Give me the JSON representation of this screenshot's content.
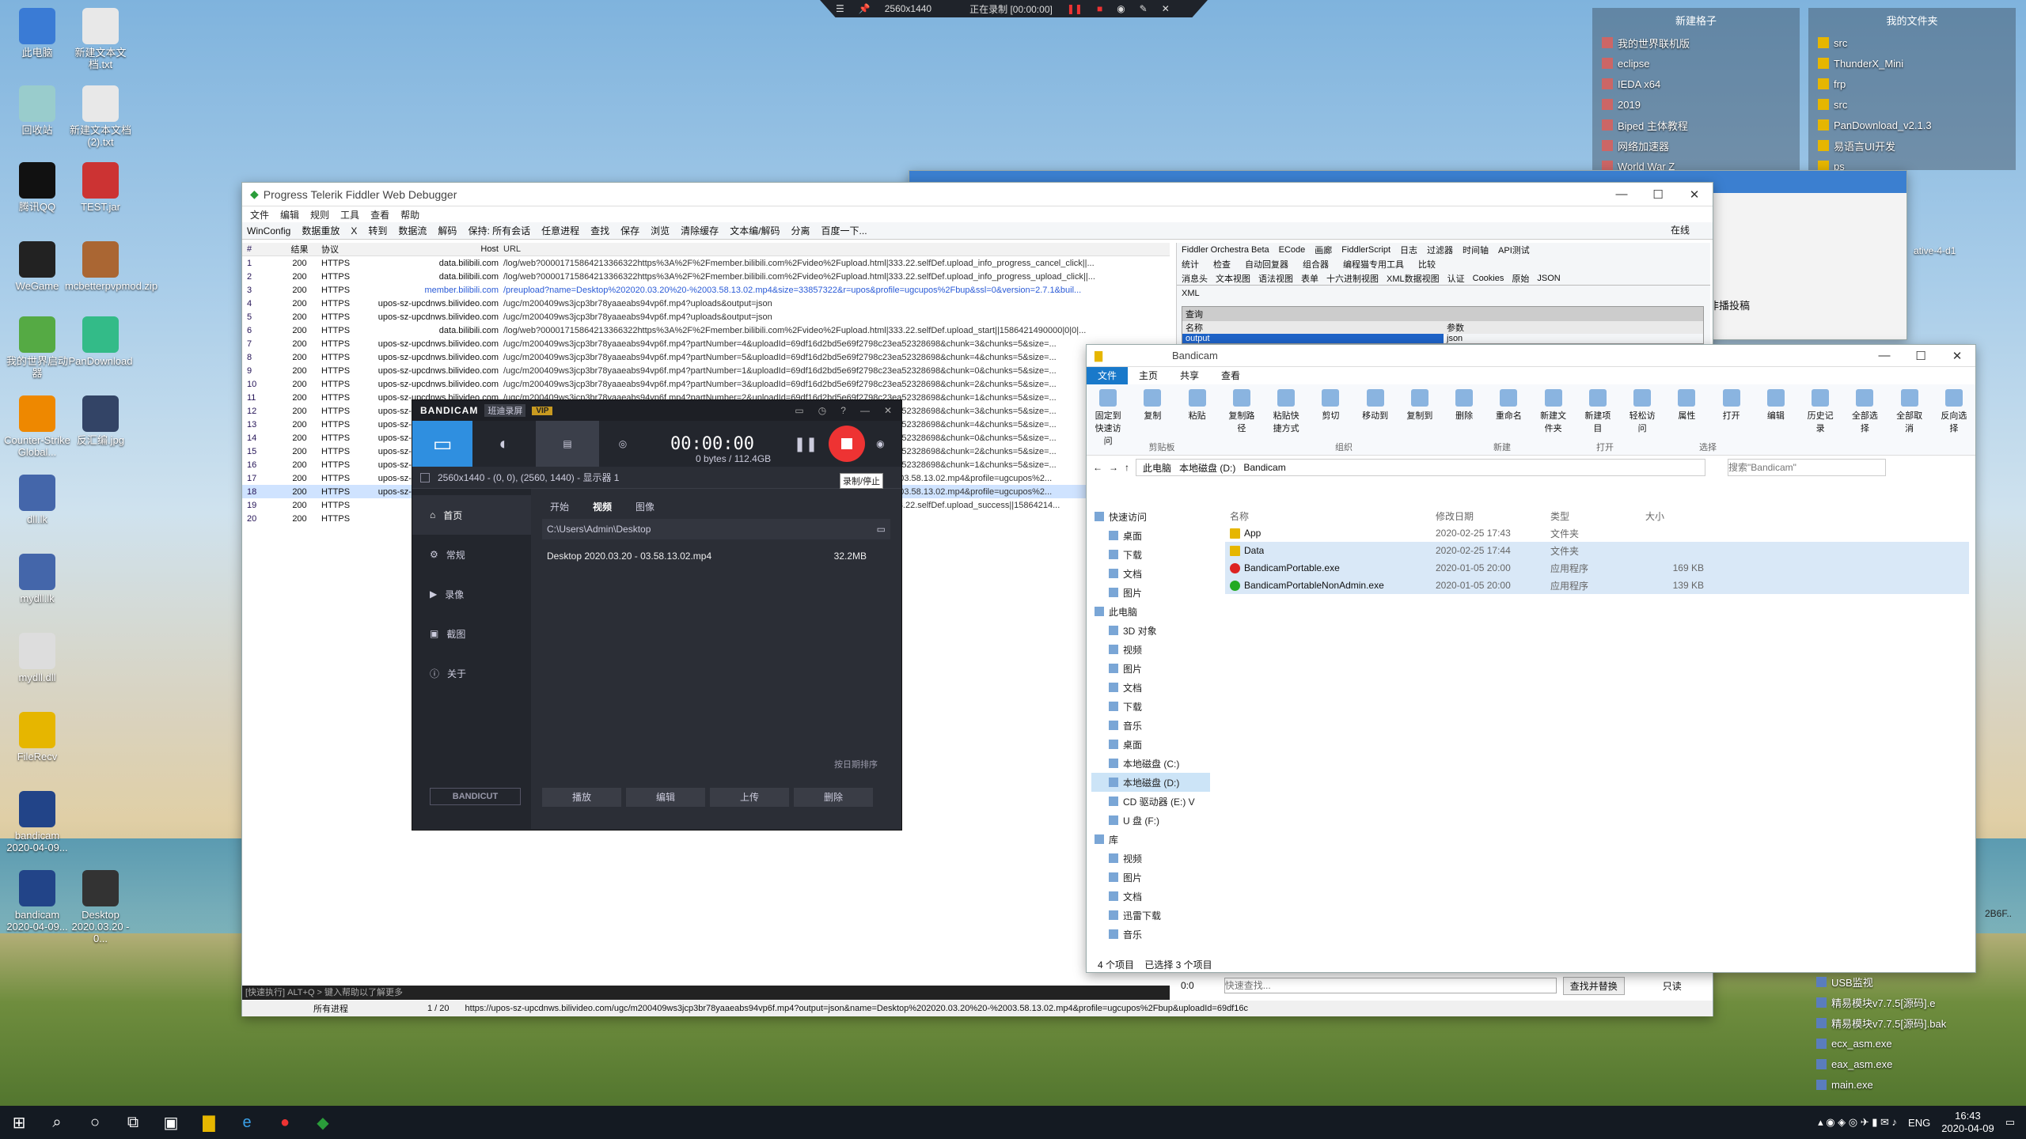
{
  "recording_bar": {
    "resolution": "2560x1440",
    "status": "正在录制 [00:00:00]"
  },
  "desktop_icons": [
    {
      "label": "此电脑",
      "color": "#3a7bd5"
    },
    {
      "label": "新建文本文档.txt",
      "color": "#e8e8e8"
    },
    {
      "label": "回收站",
      "color": "#9cc"
    },
    {
      "label": "新建文本文档 (2).txt",
      "color": "#e8e8e8"
    },
    {
      "label": "腾讯QQ",
      "color": "#111"
    },
    {
      "label": "TEST.jar",
      "color": "#c33"
    },
    {
      "label": "WeGame",
      "color": "#222"
    },
    {
      "label": "mcbetterpvpmod.zip",
      "color": "#a63"
    },
    {
      "label": "我的世界启动器",
      "color": "#5a4"
    },
    {
      "label": "PanDownload",
      "color": "#3b8"
    },
    {
      "label": "Counter-Strike Global...",
      "color": "#e80"
    },
    {
      "label": "反汇编.jpg",
      "color": "#346"
    },
    {
      "label": "dll.lk",
      "color": "#46a"
    },
    {
      "label": "mydll.lk",
      "color": "#46a"
    },
    {
      "label": "mydll.dll",
      "color": "#ddd"
    },
    {
      "label": "FileRecv",
      "color": "#e6b600"
    },
    {
      "label": "bandicam 2020-04-09...",
      "color": "#248"
    },
    {
      "label": "bandicam 2020-04-09...",
      "color": "#248"
    },
    {
      "label": "Desktop 2020.03.20 - 0...",
      "color": "#333"
    }
  ],
  "fences": [
    {
      "title": "新建格子",
      "items": [
        "我的世界联机版",
        "eclipse",
        "IEDA x64",
        "2019",
        "Biped 主体教程",
        "网络加速器",
        "World War Z"
      ]
    },
    {
      "title": "我的文件夹",
      "items": [
        "src",
        "ThunderX_Mini",
        "frp",
        "src",
        "PanDownload_v2.1.3",
        "易语言UI开发",
        "ps"
      ]
    }
  ],
  "fiddler": {
    "title": "Progress Telerik Fiddler Web Debugger",
    "menu": [
      "文件",
      "编辑",
      "规则",
      "工具",
      "查看",
      "帮助"
    ],
    "toolbar": [
      "WinConfig",
      "数据重放",
      "X",
      "转到",
      "数据流",
      "解码",
      "保持: 所有会话",
      "任意进程",
      "查找",
      "保存",
      "浏览",
      "清除缓存",
      "文本编/解码",
      "分离",
      "百度一下..."
    ],
    "columns": [
      "#",
      "结果",
      "协议",
      "Host",
      "URL"
    ],
    "sessions": [
      {
        "id": "1",
        "result": "200",
        "proto": "HTTPS",
        "host": "data.bilibili.com",
        "url": "/log/web?00001715864213366322https%3A%2F%2Fmember.bilibili.com%2Fvideo%2Fupload.html|333.22.selfDef.upload_info_progress_cancel_click||..."
      },
      {
        "id": "2",
        "result": "200",
        "proto": "HTTPS",
        "host": "data.bilibili.com",
        "url": "/log/web?00001715864213366322https%3A%2F%2Fmember.bilibili.com%2Fvideo%2Fupload.html|333.22.selfDef.upload_info_progress_upload_click||..."
      },
      {
        "id": "3",
        "result": "200",
        "proto": "HTTPS",
        "host": "member.bilibili.com",
        "url": "/preupload?name=Desktop%202020.03.20%20-%2003.58.13.02.mp4&size=33857322&r=upos&profile=ugcupos%2Fbup&ssl=0&version=2.7.1&buil..."
      },
      {
        "id": "4",
        "result": "200",
        "proto": "HTTPS",
        "host": "upos-sz-upcdnws.bilivideo.com",
        "url": "/ugc/m200409ws3jcp3br78yaaeabs94vp6f.mp4?uploads&output=json"
      },
      {
        "id": "5",
        "result": "200",
        "proto": "HTTPS",
        "host": "upos-sz-upcdnws.bilivideo.com",
        "url": "/ugc/m200409ws3jcp3br78yaaeabs94vp6f.mp4?uploads&output=json"
      },
      {
        "id": "6",
        "result": "200",
        "proto": "HTTPS",
        "host": "data.bilibili.com",
        "url": "/log/web?00001715864213366322https%3A%2F%2Fmember.bilibili.com%2Fvideo%2Fupload.html|333.22.selfDef.upload_start||1586421490000|0|0|..."
      },
      {
        "id": "7",
        "result": "200",
        "proto": "HTTPS",
        "host": "upos-sz-upcdnws.bilivideo.com",
        "url": "/ugc/m200409ws3jcp3br78yaaeabs94vp6f.mp4?partNumber=4&uploadId=69df16d2bd5e69f2798c23ea52328698&chunk=3&chunks=5&size=..."
      },
      {
        "id": "8",
        "result": "200",
        "proto": "HTTPS",
        "host": "upos-sz-upcdnws.bilivideo.com",
        "url": "/ugc/m200409ws3jcp3br78yaaeabs94vp6f.mp4?partNumber=5&uploadId=69df16d2bd5e69f2798c23ea52328698&chunk=4&chunks=5&size=..."
      },
      {
        "id": "9",
        "result": "200",
        "proto": "HTTPS",
        "host": "upos-sz-upcdnws.bilivideo.com",
        "url": "/ugc/m200409ws3jcp3br78yaaeabs94vp6f.mp4?partNumber=1&uploadId=69df16d2bd5e69f2798c23ea52328698&chunk=0&chunks=5&size=..."
      },
      {
        "id": "10",
        "result": "200",
        "proto": "HTTPS",
        "host": "upos-sz-upcdnws.bilivideo.com",
        "url": "/ugc/m200409ws3jcp3br78yaaeabs94vp6f.mp4?partNumber=3&uploadId=69df16d2bd5e69f2798c23ea52328698&chunk=2&chunks=5&size=..."
      },
      {
        "id": "11",
        "result": "200",
        "proto": "HTTPS",
        "host": "upos-sz-upcdnws.bilivideo.com",
        "url": "/ugc/m200409ws3jcp3br78yaaeabs94vp6f.mp4?partNumber=2&uploadId=69df16d2bd5e69f2798c23ea52328698&chunk=1&chunks=5&size=..."
      },
      {
        "id": "12",
        "result": "200",
        "proto": "HTTPS",
        "host": "upos-sz-upcdnws.bilivideo.com",
        "url": "/ugc/m200409ws3jcp3br78yaaeabs94vp6f.mp4?partNumber=4&uploadId=69df16d2bd5e69f2798c23ea52328698&chunk=3&chunks=5&size=..."
      },
      {
        "id": "13",
        "result": "200",
        "proto": "HTTPS",
        "host": "upos-sz-upcdnws.bilivideo.com",
        "url": "/ugc/m200409ws3jcp3br78yaaeabs94vp6f.mp4?partNumber=5&uploadId=69df16d2bd5e69f2798c23ea52328698&chunk=4&chunks=5&size=..."
      },
      {
        "id": "14",
        "result": "200",
        "proto": "HTTPS",
        "host": "upos-sz-upcdnws.bilivideo.com",
        "url": "/ugc/m200409ws3jcp3br78yaaeabs94vp6f.mp4?partNumber=1&uploadId=69df16d2bd5e69f2798c23ea52328698&chunk=0&chunks=5&size=..."
      },
      {
        "id": "15",
        "result": "200",
        "proto": "HTTPS",
        "host": "upos-sz-upcdnws.bilivideo.com",
        "url": "/ugc/m200409ws3jcp3br78yaaeabs94vp6f.mp4?partNumber=3&uploadId=69df16d2bd5e69f2798c23ea52328698&chunk=2&chunks=5&size=..."
      },
      {
        "id": "16",
        "result": "200",
        "proto": "HTTPS",
        "host": "upos-sz-upcdnws.bilivideo.com",
        "url": "/ugc/m200409ws3jcp3br78yaaeabs94vp6f.mp4?partNumber=2&uploadId=69df16d2bd5e69f2798c23ea52328698&chunk=1&chunks=5&size=..."
      },
      {
        "id": "17",
        "result": "200",
        "proto": "HTTPS",
        "host": "upos-sz-upcdnws.bilivideo.com",
        "url": "/ugc/m200409ws3jcp3br78yaaeabs94vp6f.mp4?output=json&name=Desktop%202020.03.20%20-%2003.58.13.02.mp4&profile=ugcupos%2..."
      },
      {
        "id": "18",
        "result": "200",
        "proto": "HTTPS",
        "host": "upos-sz-upcdnws.bilivideo.com",
        "url": "/ugc/m200409ws3jcp3br78yaaeabs94vp6f.mp4?output=json&name=Desktop%202020.03.20%20-%2003.58.13.02.mp4&profile=ugcupos%2..."
      },
      {
        "id": "19",
        "result": "200",
        "proto": "HTTPS",
        "host": "data.bilibili.com",
        "url": "/log/web?00001715864213366322https%3A%2F%2Fmember.bilibili.com%2Fvideo%2Fupload.html|333.22.selfDef.upload_success||15864214..."
      },
      {
        "id": "20",
        "result": "200",
        "proto": "HTTPS",
        "host": "",
        "url": ""
      }
    ],
    "right_tabs": [
      "Fiddler Orchestra Beta",
      "ECode",
      "画廊",
      "FiddlerScript",
      "日志",
      "过滤器",
      "时间轴",
      "API测试"
    ],
    "right_tabs2": [
      "统计",
      "检查",
      "自动回复器",
      "组合器",
      "编程猫专用工具",
      "比较"
    ],
    "inspector_tabs": [
      "消息头",
      "文本视图",
      "语法视图",
      "表单",
      "十六进制视图",
      "XML数据视图",
      "认证",
      "Cookies",
      "原始",
      "JSON"
    ],
    "inspector_xml": "XML",
    "qs_label": "查询",
    "qs_headers": [
      "名称",
      "参数"
    ],
    "qs_row": [
      "output",
      "json"
    ],
    "quickexec": "[快速执行] ALT+Q > 键入帮助以了解更多",
    "status": {
      "process": "所有进程",
      "count": "1 / 20",
      "url": "https://upos-sz-upcdnws.bilivideo.com/ugc/m200409ws3jcp3br78yaaeabs94vp6f.mp4?output=json&name=Desktop%202020.03.20%20-%2003.58.13.02.mp4&profile=ugcupos%2Fbup&uploadId=69df16c"
    },
    "online": "在线",
    "find_placeholder": "快速查找...",
    "find_btn": "查找并替换",
    "readonly": "只读",
    "zero": "0:0"
  },
  "bandicam": {
    "brand": "BANDICAM",
    "sub": "班迪录屏",
    "vip": "VIP",
    "timer": "00:00:00",
    "size": "0 bytes / 112.4GB",
    "tooltip": "录制/停止",
    "area": "2560x1440 - (0, 0), (2560, 1440) - 显示器 1",
    "sidebar": [
      "首页",
      "常规",
      "录像",
      "截图",
      "关于"
    ],
    "tabs": [
      "开始",
      "视频",
      "图像"
    ],
    "path": "C:\\Users\\Admin\\Desktop",
    "file": {
      "name": "Desktop 2020.03.20 - 03.58.13.02.mp4",
      "size": "32.2MB"
    },
    "sort": "按日期排序",
    "bottom_btns": [
      "播放",
      "编辑",
      "上传",
      "删除"
    ],
    "bandicut": "BANDICUT"
  },
  "explorer": {
    "title": "Bandicam",
    "tabs": [
      "文件",
      "主页",
      "共享",
      "查看"
    ],
    "ribbon": {
      "clipboard": [
        "固定到快速访问",
        "复制",
        "粘贴",
        "复制路径",
        "粘贴快捷方式",
        "剪切"
      ],
      "organize": [
        "移动到",
        "复制到",
        "删除",
        "重命名"
      ],
      "new": [
        "新建文件夹",
        "新建项目",
        "轻松访问"
      ],
      "open": [
        "属性",
        "打开",
        "编辑",
        "历史记录"
      ],
      "select": [
        "全部选择",
        "全部取消",
        "反向选择"
      ],
      "groups": [
        "剪贴板",
        "组织",
        "新建",
        "打开",
        "选择"
      ]
    },
    "breadcrumb": [
      "此电脑",
      "本地磁盘 (D:)",
      "Bandicam"
    ],
    "search_placeholder": "搜索\"Bandicam\"",
    "nav": [
      "快速访问",
      "桌面",
      "下载",
      "文档",
      "图片",
      "此电脑",
      "3D 对象",
      "视频",
      "图片",
      "文档",
      "下载",
      "音乐",
      "桌面",
      "本地磁盘 (C:)",
      "本地磁盘 (D:)",
      "CD 驱动器 (E:) V",
      "U 盘 (F:)",
      "库",
      "视频",
      "图片",
      "文档",
      "迅雷下载",
      "音乐"
    ],
    "columns": [
      "名称",
      "修改日期",
      "类型",
      "大小"
    ],
    "files": [
      {
        "name": "App",
        "date": "2020-02-25 17:43",
        "type": "文件夹",
        "size": "",
        "icon": "folder"
      },
      {
        "name": "Data",
        "date": "2020-02-25 17:44",
        "type": "文件夹",
        "size": "",
        "icon": "folder"
      },
      {
        "name": "BandicamPortable.exe",
        "date": "2020-01-05 20:00",
        "type": "应用程序",
        "size": "169 KB",
        "icon": "red"
      },
      {
        "name": "BandicamPortableNonAdmin.exe",
        "date": "2020-01-05 20:00",
        "type": "应用程序",
        "size": "139 KB",
        "icon": "green"
      }
    ],
    "status": "4 个项目    已选择 3 个项目"
  },
  "browser_bg": {
    "text1": "ative-4-d1",
    "text2": "非播投稿"
  },
  "right_list": [
    "USB监视",
    "精易模块v7.7.5[源码].e",
    "精易模块v7.7.5[源码].bak",
    "ecx_asm.exe",
    "eax_asm.exe",
    "main.exe"
  ],
  "right_partial": "2B6F..",
  "taskbar": {
    "lang": "ENG",
    "time": "16:43",
    "date": "2020-04-09"
  }
}
